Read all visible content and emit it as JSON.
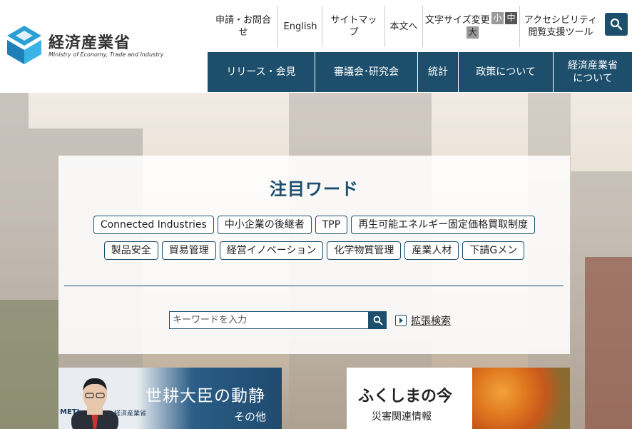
{
  "header": {
    "logo_ja": "経済産業省",
    "logo_en": "Ministry of Economy, Trade and Industry",
    "util": {
      "contact": "申請・お問合せ",
      "english": "English",
      "sitemap": "サイトマップ",
      "skip": "本文へ",
      "fontsize_label": "文字サイズ変更",
      "fs_small": "小",
      "fs_medium": "中",
      "fs_large": "大",
      "accessibility": "アクセシビリティ閲覧支援ツール"
    },
    "nav": [
      "リリース・会見",
      "審議会･研究会",
      "統計",
      "政策について",
      "経済産業省について"
    ]
  },
  "keywords": {
    "title": "注目ワード",
    "row1": [
      "Connected Industries",
      "中小企業の後継者",
      "TPP",
      "再生可能エネルギー固定価格買取制度"
    ],
    "row2": [
      "製品安全",
      "貿易管理",
      "経営イノベーション",
      "化学物質管理",
      "産業人材",
      "下請Gメン"
    ],
    "search_placeholder": "キーワードを入力",
    "advanced_search": "拡張検索"
  },
  "banners": {
    "left_title": "世耕大臣の動静",
    "left_sub": "その他",
    "left_meti": "METI",
    "left_org": "経済産業省",
    "right_title": "ふくしまの今",
    "right_sub": "災害関連情報"
  },
  "colors": {
    "brand": "#1d4f6c",
    "logo_blue": "#2a9fd6"
  }
}
